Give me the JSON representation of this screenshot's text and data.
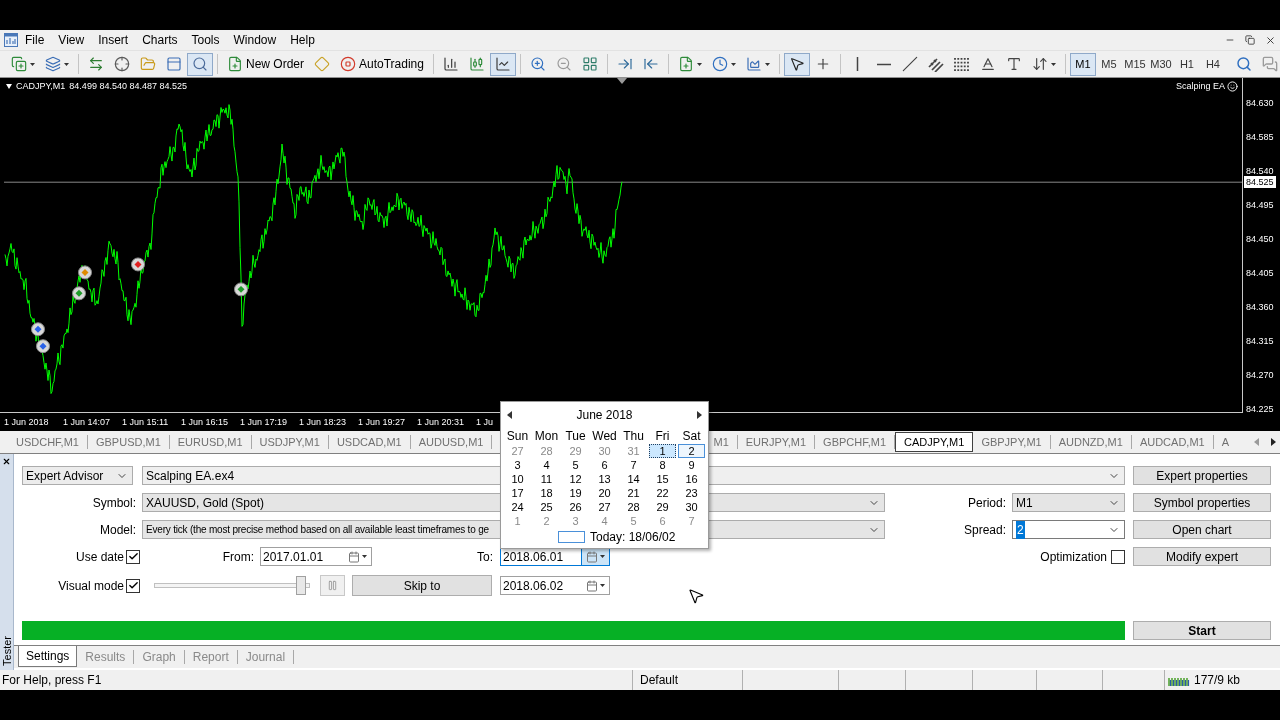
{
  "menu": [
    "File",
    "View",
    "Insert",
    "Charts",
    "Tools",
    "Window",
    "Help"
  ],
  "toolbar": {
    "buttons": [
      {
        "pressed": false
      },
      {
        "pressed": false
      },
      {
        "pressed": false
      },
      {
        "pressed": false
      },
      {
        "pressed": false
      },
      {
        "pressed": false
      },
      {
        "pressed": true
      },
      {
        "label": "New Order",
        "pressed": false
      },
      {
        "pressed": false
      },
      {
        "label": "AutoTrading",
        "pressed": false
      },
      {
        "pressed": false
      },
      {
        "pressed": false
      },
      {
        "pressed": true
      },
      {
        "pressed": false
      },
      {
        "pressed": false
      },
      {
        "pressed": false
      },
      {
        "pressed": false
      },
      {
        "pressed": false
      },
      {
        "pressed": false
      },
      {
        "pressed": false
      },
      {
        "pressed": false
      },
      {
        "pressed": true
      },
      {
        "pressed": false
      },
      {
        "pressed": false
      },
      {
        "pressed": false
      },
      {
        "pressed": false
      },
      {
        "pressed": false
      },
      {
        "pressed": false
      },
      {
        "pressed": false
      },
      {
        "pressed": false
      },
      {
        "pressed": false
      }
    ],
    "timeframes": [
      {
        "label": "M1",
        "selected": true
      },
      {
        "label": "M5",
        "selected": false
      },
      {
        "label": "M15",
        "selected": false
      },
      {
        "label": "M30",
        "selected": false
      },
      {
        "label": "H1",
        "selected": false
      },
      {
        "label": "H4",
        "selected": false
      }
    ]
  },
  "chart": {
    "symbol": "CADJPY,M1",
    "quotes": "84.499 84.540 84.487 84.525",
    "expert": "Scalping EA",
    "price_ticks": [
      "84.630",
      "84.585",
      "84.540",
      "84.495",
      "84.450",
      "84.405",
      "84.360",
      "84.315",
      "84.270",
      "84.225"
    ],
    "current_price": "84.525",
    "time_ticks": [
      "1 Jun 2018",
      "1 Jun 14:07",
      "1 Jun 15:11",
      "1 Jun 16:15",
      "1 Jun 17:19",
      "1 Jun 18:23",
      "1 Jun 19:27",
      "1 Jun 20:31",
      "1 Ju"
    ]
  },
  "chart_tabs": [
    {
      "label": "USDCHF,M1",
      "selected": false
    },
    {
      "label": "GBPUSD,M1",
      "selected": false
    },
    {
      "label": "EURUSD,M1",
      "selected": false
    },
    {
      "label": "USDJPY,M1",
      "selected": false
    },
    {
      "label": "USDCAD,M1",
      "selected": false
    },
    {
      "label": "AUDUSD,M1",
      "selected": false
    },
    {
      "label": "M1",
      "selected": false
    },
    {
      "label": "EURJPY,M1",
      "selected": false
    },
    {
      "label": "GBPCHF,M1",
      "selected": false
    },
    {
      "label": "CADJPY,M1",
      "selected": true
    },
    {
      "label": "GBPJPY,M1",
      "selected": false
    },
    {
      "label": "AUDNZD,M1",
      "selected": false
    },
    {
      "label": "AUDCAD,M1",
      "selected": false
    },
    {
      "label": "A",
      "selected": false
    }
  ],
  "calendar": {
    "month": "June 2018",
    "weekdays": [
      "Sun",
      "Mon",
      "Tue",
      "Wed",
      "Thu",
      "Fri",
      "Sat"
    ],
    "weeks": [
      [
        {
          "label": "27",
          "outside": true,
          "selected": false,
          "today": false
        },
        {
          "label": "28",
          "outside": true,
          "selected": false,
          "today": false
        },
        {
          "label": "29",
          "outside": true,
          "selected": false,
          "today": false
        },
        {
          "label": "30",
          "outside": true,
          "selected": false,
          "today": false
        },
        {
          "label": "31",
          "outside": true,
          "selected": false,
          "today": false
        },
        {
          "label": "1",
          "outside": false,
          "selected": true,
          "today": false
        },
        {
          "label": "2",
          "outside": false,
          "selected": false,
          "today": true
        }
      ],
      [
        {
          "label": "3",
          "outside": false,
          "selected": false,
          "today": false
        },
        {
          "label": "4",
          "outside": false,
          "selected": false,
          "today": false
        },
        {
          "label": "5",
          "outside": false,
          "selected": false,
          "today": false
        },
        {
          "label": "6",
          "outside": false,
          "selected": false,
          "today": false
        },
        {
          "label": "7",
          "outside": false,
          "selected": false,
          "today": false
        },
        {
          "label": "8",
          "outside": false,
          "selected": false,
          "today": false
        },
        {
          "label": "9",
          "outside": false,
          "selected": false,
          "today": false
        }
      ],
      [
        {
          "label": "10",
          "outside": false,
          "selected": false,
          "today": false
        },
        {
          "label": "11",
          "outside": false,
          "selected": false,
          "today": false
        },
        {
          "label": "12",
          "outside": false,
          "selected": false,
          "today": false
        },
        {
          "label": "13",
          "outside": false,
          "selected": false,
          "today": false
        },
        {
          "label": "14",
          "outside": false,
          "selected": false,
          "today": false
        },
        {
          "label": "15",
          "outside": false,
          "selected": false,
          "today": false
        },
        {
          "label": "16",
          "outside": false,
          "selected": false,
          "today": false
        }
      ],
      [
        {
          "label": "17",
          "outside": false,
          "selected": false,
          "today": false
        },
        {
          "label": "18",
          "outside": false,
          "selected": false,
          "today": false
        },
        {
          "label": "19",
          "outside": false,
          "selected": false,
          "today": false
        },
        {
          "label": "20",
          "outside": false,
          "selected": false,
          "today": false
        },
        {
          "label": "21",
          "outside": false,
          "selected": false,
          "today": false
        },
        {
          "label": "22",
          "outside": false,
          "selected": false,
          "today": false
        },
        {
          "label": "23",
          "outside": false,
          "selected": false,
          "today": false
        }
      ],
      [
        {
          "label": "24",
          "outside": false,
          "selected": false,
          "today": false
        },
        {
          "label": "25",
          "outside": false,
          "selected": false,
          "today": false
        },
        {
          "label": "26",
          "outside": false,
          "selected": false,
          "today": false
        },
        {
          "label": "27",
          "outside": false,
          "selected": false,
          "today": false
        },
        {
          "label": "28",
          "outside": false,
          "selected": false,
          "today": false
        },
        {
          "label": "29",
          "outside": false,
          "selected": false,
          "today": false
        },
        {
          "label": "30",
          "outside": false,
          "selected": false,
          "today": false
        }
      ],
      [
        {
          "label": "1",
          "outside": true,
          "selected": false,
          "today": false
        },
        {
          "label": "2",
          "outside": true,
          "selected": false,
          "today": false
        },
        {
          "label": "3",
          "outside": true,
          "selected": false,
          "today": false
        },
        {
          "label": "4",
          "outside": true,
          "selected": false,
          "today": false
        },
        {
          "label": "5",
          "outside": true,
          "selected": false,
          "today": false
        },
        {
          "label": "6",
          "outside": true,
          "selected": false,
          "today": false
        },
        {
          "label": "7",
          "outside": true,
          "selected": false,
          "today": false
        }
      ]
    ],
    "today": "Today: 18/06/02"
  },
  "tester": {
    "side_label": "Tester",
    "expert_type": "Expert Advisor",
    "expert": "Scalping EA.ex4",
    "symbol": {
      "label": "Symbol:",
      "value": "XAUUSD, Gold (Spot)"
    },
    "model": {
      "label": "Model:",
      "value": "Every tick (the most precise method based on all available least timeframes to ge"
    },
    "period": {
      "label": "Period:",
      "value": "M1"
    },
    "spread": {
      "label": "Spread:",
      "value": "2",
      "text_selected": true
    },
    "use_date": {
      "label": "Use date",
      "checked": true
    },
    "from": {
      "label": "From:",
      "value": "2017.01.01"
    },
    "to": {
      "label": "To:",
      "value": "2018.06.01",
      "focused": true
    },
    "optimization": {
      "label": "Optimization",
      "checked": false
    },
    "visual_mode": {
      "label": "Visual mode",
      "checked": true
    },
    "speed": {
      "level": 0.95
    },
    "skip_to": {
      "button": "Skip to",
      "value": "2018.06.02"
    },
    "progress": {
      "level": 1
    },
    "buttons": [
      "Expert properties",
      "Symbol properties",
      "Open chart",
      "Modify expert"
    ],
    "start": "Start",
    "tabs": [
      {
        "label": "Settings",
        "selected": true
      },
      {
        "label": "Results",
        "selected": false
      },
      {
        "label": "Graph",
        "selected": false
      },
      {
        "label": "Report",
        "selected": false
      },
      {
        "label": "Journal",
        "selected": false
      }
    ]
  },
  "status_bar": {
    "help": "For Help, press F1",
    "profile": "Default",
    "traffic": "177/9 kb"
  }
}
